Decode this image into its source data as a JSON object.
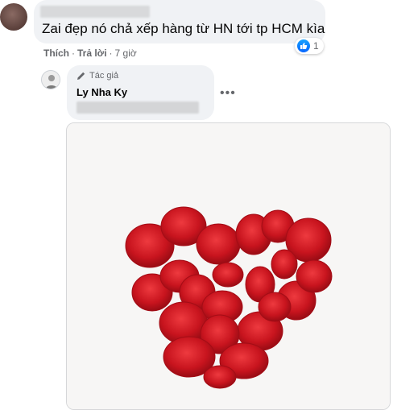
{
  "comment": {
    "text": "Zai đẹp nó chả xếp hàng từ HN tới tp HCM kìa",
    "reaction_count": "1",
    "like_label": "Thích",
    "reply_label": "Trả lời",
    "time": "7 giờ"
  },
  "reply": {
    "badge": "Tác giả",
    "author": "Ly Nha Ky",
    "more": "•••"
  },
  "image": {
    "subject": "heart-of-rose-petals",
    "petal_color": "#c8141e"
  }
}
